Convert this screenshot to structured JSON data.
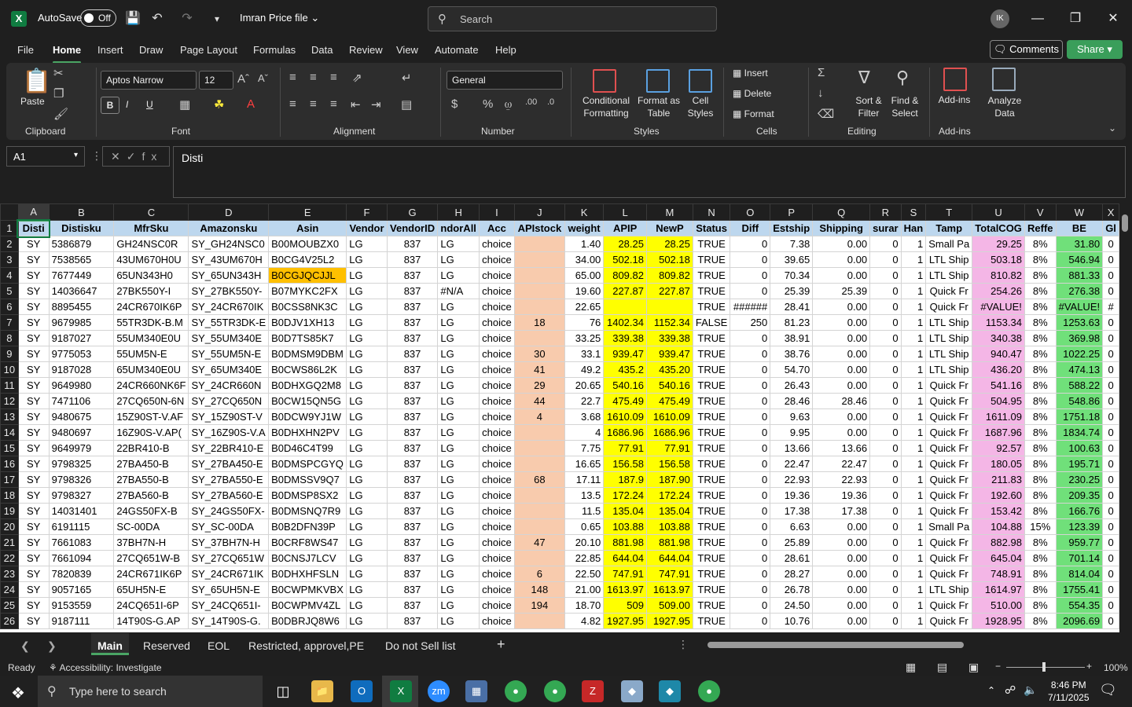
{
  "titlebar": {
    "app_logo": "X",
    "autosave_label": "AutoSave",
    "autosave_state": "Off",
    "filename": "Imran Price file",
    "search_placeholder": "Search",
    "avatar_initials": "IK"
  },
  "menu": {
    "tabs": [
      "File",
      "Home",
      "Insert",
      "Draw",
      "Page Layout",
      "Formulas",
      "Data",
      "Review",
      "View",
      "Automate",
      "Help"
    ],
    "active": "Home",
    "comments_label": "Comments",
    "share_label": "Share"
  },
  "ribbon": {
    "clipboard": {
      "paste": "Paste",
      "group": "Clipboard"
    },
    "font": {
      "name": "Aptos Narrow",
      "size": "12",
      "group": "Font",
      "bold": "B",
      "italic": "I",
      "underline": "U"
    },
    "alignment": {
      "group": "Alignment"
    },
    "number": {
      "format": "General",
      "group": "Number"
    },
    "styles": {
      "conditional": "Conditional",
      "conditional2": "Formatting",
      "format_table": "Format as",
      "format_table2": "Table",
      "cell_styles": "Cell",
      "cell_styles2": "Styles",
      "group": "Styles"
    },
    "cells": {
      "insert": "Insert",
      "delete": "Delete",
      "format": "Format",
      "group": "Cells"
    },
    "editing": {
      "sort": "Sort &",
      "sort2": "Filter",
      "find": "Find &",
      "find2": "Select",
      "group": "Editing"
    },
    "addins": {
      "addins": "Add-ins",
      "analyze": "Analyze",
      "analyze2": "Data",
      "group": "Add-ins"
    }
  },
  "formula_bar": {
    "cell_ref": "A1",
    "content": "Disti"
  },
  "columns": [
    "A",
    "B",
    "C",
    "D",
    "E",
    "F",
    "G",
    "H",
    "I",
    "J",
    "K",
    "L",
    "M",
    "N",
    "O",
    "P",
    "Q",
    "R",
    "S",
    "T",
    "U",
    "V",
    "W",
    "X"
  ],
  "headers": [
    "Disti",
    "Distisku",
    "MfrSku",
    "Amazonsku",
    "Asin",
    "Vendor",
    "VendorID",
    "ndorAll",
    "Acc",
    "APIstock",
    "weight",
    "APIP",
    "NewP",
    "Status",
    "Diff",
    "Estship",
    "Shipping",
    "surar",
    "Han",
    "Tamp",
    "TotalCOG",
    "Reffe",
    "BE",
    "Gl"
  ],
  "rows": [
    [
      "2",
      "SY",
      "5386879",
      "GH24NSC0R",
      "SY_GH24NSC0",
      "B00MOUBZX0",
      "LG",
      "837",
      "LG",
      "choice",
      "",
      "1.40",
      "28.25",
      "28.25",
      "TRUE",
      "0",
      "7.38",
      "0.00",
      "0",
      "1",
      "Small Pa",
      "29.25",
      "8%",
      "31.80",
      "0"
    ],
    [
      "3",
      "SY",
      "7538565",
      "43UM670H0U",
      "SY_43UM670H",
      "B0CG4V25L2",
      "LG",
      "837",
      "LG",
      "choice",
      "",
      "34.00",
      "502.18",
      "502.18",
      "TRUE",
      "0",
      "39.65",
      "0.00",
      "0",
      "1",
      "LTL Ship",
      "503.18",
      "8%",
      "546.94",
      "0"
    ],
    [
      "4",
      "SY",
      "7677449",
      "65UN343H0",
      "SY_65UN343H",
      "B0CGJQCJJL",
      "LG",
      "837",
      "LG",
      "choice",
      "",
      "65.00",
      "809.82",
      "809.82",
      "TRUE",
      "0",
      "70.34",
      "0.00",
      "0",
      "1",
      "LTL Ship",
      "810.82",
      "8%",
      "881.33",
      "0"
    ],
    [
      "5",
      "SY",
      "14036647",
      "27BK550Y-I",
      "SY_27BK550Y-",
      "B07MYKC2FX",
      "LG",
      "837",
      "#N/A",
      "choice",
      "",
      "19.60",
      "227.87",
      "227.87",
      "TRUE",
      "0",
      "25.39",
      "25.39",
      "0",
      "1",
      "Quick Fr",
      "254.26",
      "8%",
      "276.38",
      "0"
    ],
    [
      "6",
      "SY",
      "8895455",
      "24CR670IK6P",
      "SY_24CR670IK",
      "B0CSS8NK3C",
      "LG",
      "837",
      "LG",
      "choice",
      "",
      "22.65",
      "",
      "",
      "TRUE",
      "######",
      "28.41",
      "0.00",
      "0",
      "1",
      "Quick Fr",
      "#VALUE!",
      "8%",
      "#VALUE!",
      "#"
    ],
    [
      "7",
      "SY",
      "9679985",
      "55TR3DK-B.M",
      "SY_55TR3DK-E",
      "B0DJV1XH13",
      "LG",
      "837",
      "LG",
      "choice",
      "18",
      "76",
      "1402.34",
      "1152.34",
      "FALSE",
      "250",
      "81.23",
      "0.00",
      "0",
      "1",
      "LTL Ship",
      "1153.34",
      "8%",
      "1253.63",
      "0"
    ],
    [
      "8",
      "SY",
      "9187027",
      "55UM340E0U",
      "SY_55UM340E",
      "B0D7TS85K7",
      "LG",
      "837",
      "LG",
      "choice",
      "",
      "33.25",
      "339.38",
      "339.38",
      "TRUE",
      "0",
      "38.91",
      "0.00",
      "0",
      "1",
      "LTL Ship",
      "340.38",
      "8%",
      "369.98",
      "0"
    ],
    [
      "9",
      "SY",
      "9775053",
      "55UM5N-E",
      "SY_55UM5N-E",
      "B0DMSM9DBM",
      "LG",
      "837",
      "LG",
      "choice",
      "30",
      "33.1",
      "939.47",
      "939.47",
      "TRUE",
      "0",
      "38.76",
      "0.00",
      "0",
      "1",
      "LTL Ship",
      "940.47",
      "8%",
      "1022.25",
      "0"
    ],
    [
      "10",
      "SY",
      "9187028",
      "65UM340E0U",
      "SY_65UM340E",
      "B0CWS86L2K",
      "LG",
      "837",
      "LG",
      "choice",
      "41",
      "49.2",
      "435.2",
      "435.20",
      "TRUE",
      "0",
      "54.70",
      "0.00",
      "0",
      "1",
      "LTL Ship",
      "436.20",
      "8%",
      "474.13",
      "0"
    ],
    [
      "11",
      "SY",
      "9649980",
      "24CR660NK6F",
      "SY_24CR660N",
      "B0DHXGQ2M8",
      "LG",
      "837",
      "LG",
      "choice",
      "29",
      "20.65",
      "540.16",
      "540.16",
      "TRUE",
      "0",
      "26.43",
      "0.00",
      "0",
      "1",
      "Quick Fr",
      "541.16",
      "8%",
      "588.22",
      "0"
    ],
    [
      "12",
      "SY",
      "7471106",
      "27CQ650N-6N",
      "SY_27CQ650N",
      "B0CW15QN5G",
      "LG",
      "837",
      "LG",
      "choice",
      "44",
      "22.7",
      "475.49",
      "475.49",
      "TRUE",
      "0",
      "28.46",
      "28.46",
      "0",
      "1",
      "Quick Fr",
      "504.95",
      "8%",
      "548.86",
      "0"
    ],
    [
      "13",
      "SY",
      "9480675",
      "15Z90ST-V.AF",
      "SY_15Z90ST-V",
      "B0DCW9YJ1W",
      "LG",
      "837",
      "LG",
      "choice",
      "4",
      "3.68",
      "1610.09",
      "1610.09",
      "TRUE",
      "0",
      "9.63",
      "0.00",
      "0",
      "1",
      "Quick Fr",
      "1611.09",
      "8%",
      "1751.18",
      "0"
    ],
    [
      "14",
      "SY",
      "9480697",
      "16Z90S-V.AP(",
      "SY_16Z90S-V.A",
      "B0DHXHN2PV",
      "LG",
      "837",
      "LG",
      "choice",
      "",
      "4",
      "1686.96",
      "1686.96",
      "TRUE",
      "0",
      "9.95",
      "0.00",
      "0",
      "1",
      "Quick Fr",
      "1687.96",
      "8%",
      "1834.74",
      "0"
    ],
    [
      "15",
      "SY",
      "9649979",
      "22BR410-B",
      "SY_22BR410-E",
      "B0D46C4T99",
      "LG",
      "837",
      "LG",
      "choice",
      "",
      "7.75",
      "77.91",
      "77.91",
      "TRUE",
      "0",
      "13.66",
      "13.66",
      "0",
      "1",
      "Quick Fr",
      "92.57",
      "8%",
      "100.63",
      "0"
    ],
    [
      "16",
      "SY",
      "9798325",
      "27BA450-B",
      "SY_27BA450-E",
      "B0DMSPCGYQ",
      "LG",
      "837",
      "LG",
      "choice",
      "",
      "16.65",
      "156.58",
      "156.58",
      "TRUE",
      "0",
      "22.47",
      "22.47",
      "0",
      "1",
      "Quick Fr",
      "180.05",
      "8%",
      "195.71",
      "0"
    ],
    [
      "17",
      "SY",
      "9798326",
      "27BA550-B",
      "SY_27BA550-E",
      "B0DMSSV9Q7",
      "LG",
      "837",
      "LG",
      "choice",
      "68",
      "17.11",
      "187.9",
      "187.90",
      "TRUE",
      "0",
      "22.93",
      "22.93",
      "0",
      "1",
      "Quick Fr",
      "211.83",
      "8%",
      "230.25",
      "0"
    ],
    [
      "18",
      "SY",
      "9798327",
      "27BA560-B",
      "SY_27BA560-E",
      "B0DMSP8SX2",
      "LG",
      "837",
      "LG",
      "choice",
      "",
      "13.5",
      "172.24",
      "172.24",
      "TRUE",
      "0",
      "19.36",
      "19.36",
      "0",
      "1",
      "Quick Fr",
      "192.60",
      "8%",
      "209.35",
      "0"
    ],
    [
      "19",
      "SY",
      "14031401",
      "24GS50FX-B",
      "SY_24GS50FX-",
      "B0DMSNQ7R9",
      "LG",
      "837",
      "LG",
      "choice",
      "",
      "11.5",
      "135.04",
      "135.04",
      "TRUE",
      "0",
      "17.38",
      "17.38",
      "0",
      "1",
      "Quick Fr",
      "153.42",
      "8%",
      "166.76",
      "0"
    ],
    [
      "20",
      "SY",
      "6191115",
      "SC-00DA",
      "SY_SC-00DA",
      "B0B2DFN39P",
      "LG",
      "837",
      "LG",
      "choice",
      "",
      "0.65",
      "103.88",
      "103.88",
      "TRUE",
      "0",
      "6.63",
      "0.00",
      "0",
      "1",
      "Small Pa",
      "104.88",
      "15%",
      "123.39",
      "0"
    ],
    [
      "21",
      "SY",
      "7661083",
      "37BH7N-H",
      "SY_37BH7N-H",
      "B0CRF8WS47",
      "LG",
      "837",
      "LG",
      "choice",
      "47",
      "20.10",
      "881.98",
      "881.98",
      "TRUE",
      "0",
      "25.89",
      "0.00",
      "0",
      "1",
      "Quick Fr",
      "882.98",
      "8%",
      "959.77",
      "0"
    ],
    [
      "22",
      "SY",
      "7661094",
      "27CQ651W-B",
      "SY_27CQ651W",
      "B0CNSJ7LCV",
      "LG",
      "837",
      "LG",
      "choice",
      "",
      "22.85",
      "644.04",
      "644.04",
      "TRUE",
      "0",
      "28.61",
      "0.00",
      "0",
      "1",
      "Quick Fr",
      "645.04",
      "8%",
      "701.14",
      "0"
    ],
    [
      "23",
      "SY",
      "7820839",
      "24CR671IK6P",
      "SY_24CR671IK",
      "B0DHXHFSLN",
      "LG",
      "837",
      "LG",
      "choice",
      "6",
      "22.50",
      "747.91",
      "747.91",
      "TRUE",
      "0",
      "28.27",
      "0.00",
      "0",
      "1",
      "Quick Fr",
      "748.91",
      "8%",
      "814.04",
      "0"
    ],
    [
      "24",
      "SY",
      "9057165",
      "65UH5N-E",
      "SY_65UH5N-E",
      "B0CWPMKVBX",
      "LG",
      "837",
      "LG",
      "choice",
      "148",
      "21.00",
      "1613.97",
      "1613.97",
      "TRUE",
      "0",
      "26.78",
      "0.00",
      "0",
      "1",
      "LTL Ship",
      "1614.97",
      "8%",
      "1755.41",
      "0"
    ],
    [
      "25",
      "SY",
      "9153559",
      "24CQ651I-6P",
      "SY_24CQ651I-",
      "B0CWPMV4ZL",
      "LG",
      "837",
      "LG",
      "choice",
      "194",
      "18.70",
      "509",
      "509.00",
      "TRUE",
      "0",
      "24.50",
      "0.00",
      "0",
      "1",
      "Quick Fr",
      "510.00",
      "8%",
      "554.35",
      "0"
    ],
    [
      "26",
      "SY",
      "9187111",
      "14T90S-G.AP",
      "SY_14T90S-G.",
      "B0DBRJQ8W6",
      "LG",
      "837",
      "LG",
      "choice",
      "",
      "4.82",
      "1927.95",
      "1927.95",
      "TRUE",
      "0",
      "10.76",
      "0.00",
      "0",
      "1",
      "Quick Fr",
      "1928.95",
      "8%",
      "2096.69",
      "0"
    ]
  ],
  "sheet_tabs": [
    "Main",
    "Reserved",
    "EOL",
    "Restricted, approvel,PE",
    "Do not Sell list"
  ],
  "active_sheet": "Main",
  "status": {
    "ready": "Ready",
    "accessibility": "Accessibility: Investigate",
    "zoom": "100%"
  },
  "taskbar": {
    "search_placeholder": "Type here to search",
    "time": "8:46 PM",
    "date": "7/11/2025"
  },
  "colors": {
    "header_fill": "#bdd7ee",
    "apistock_fill": "#f8cbad",
    "price_fill": "#ffff00",
    "cog_fill": "#f4b6e6",
    "be_fill": "#70e07a",
    "highlight": "#ffc000",
    "accent": "#4aa564"
  }
}
